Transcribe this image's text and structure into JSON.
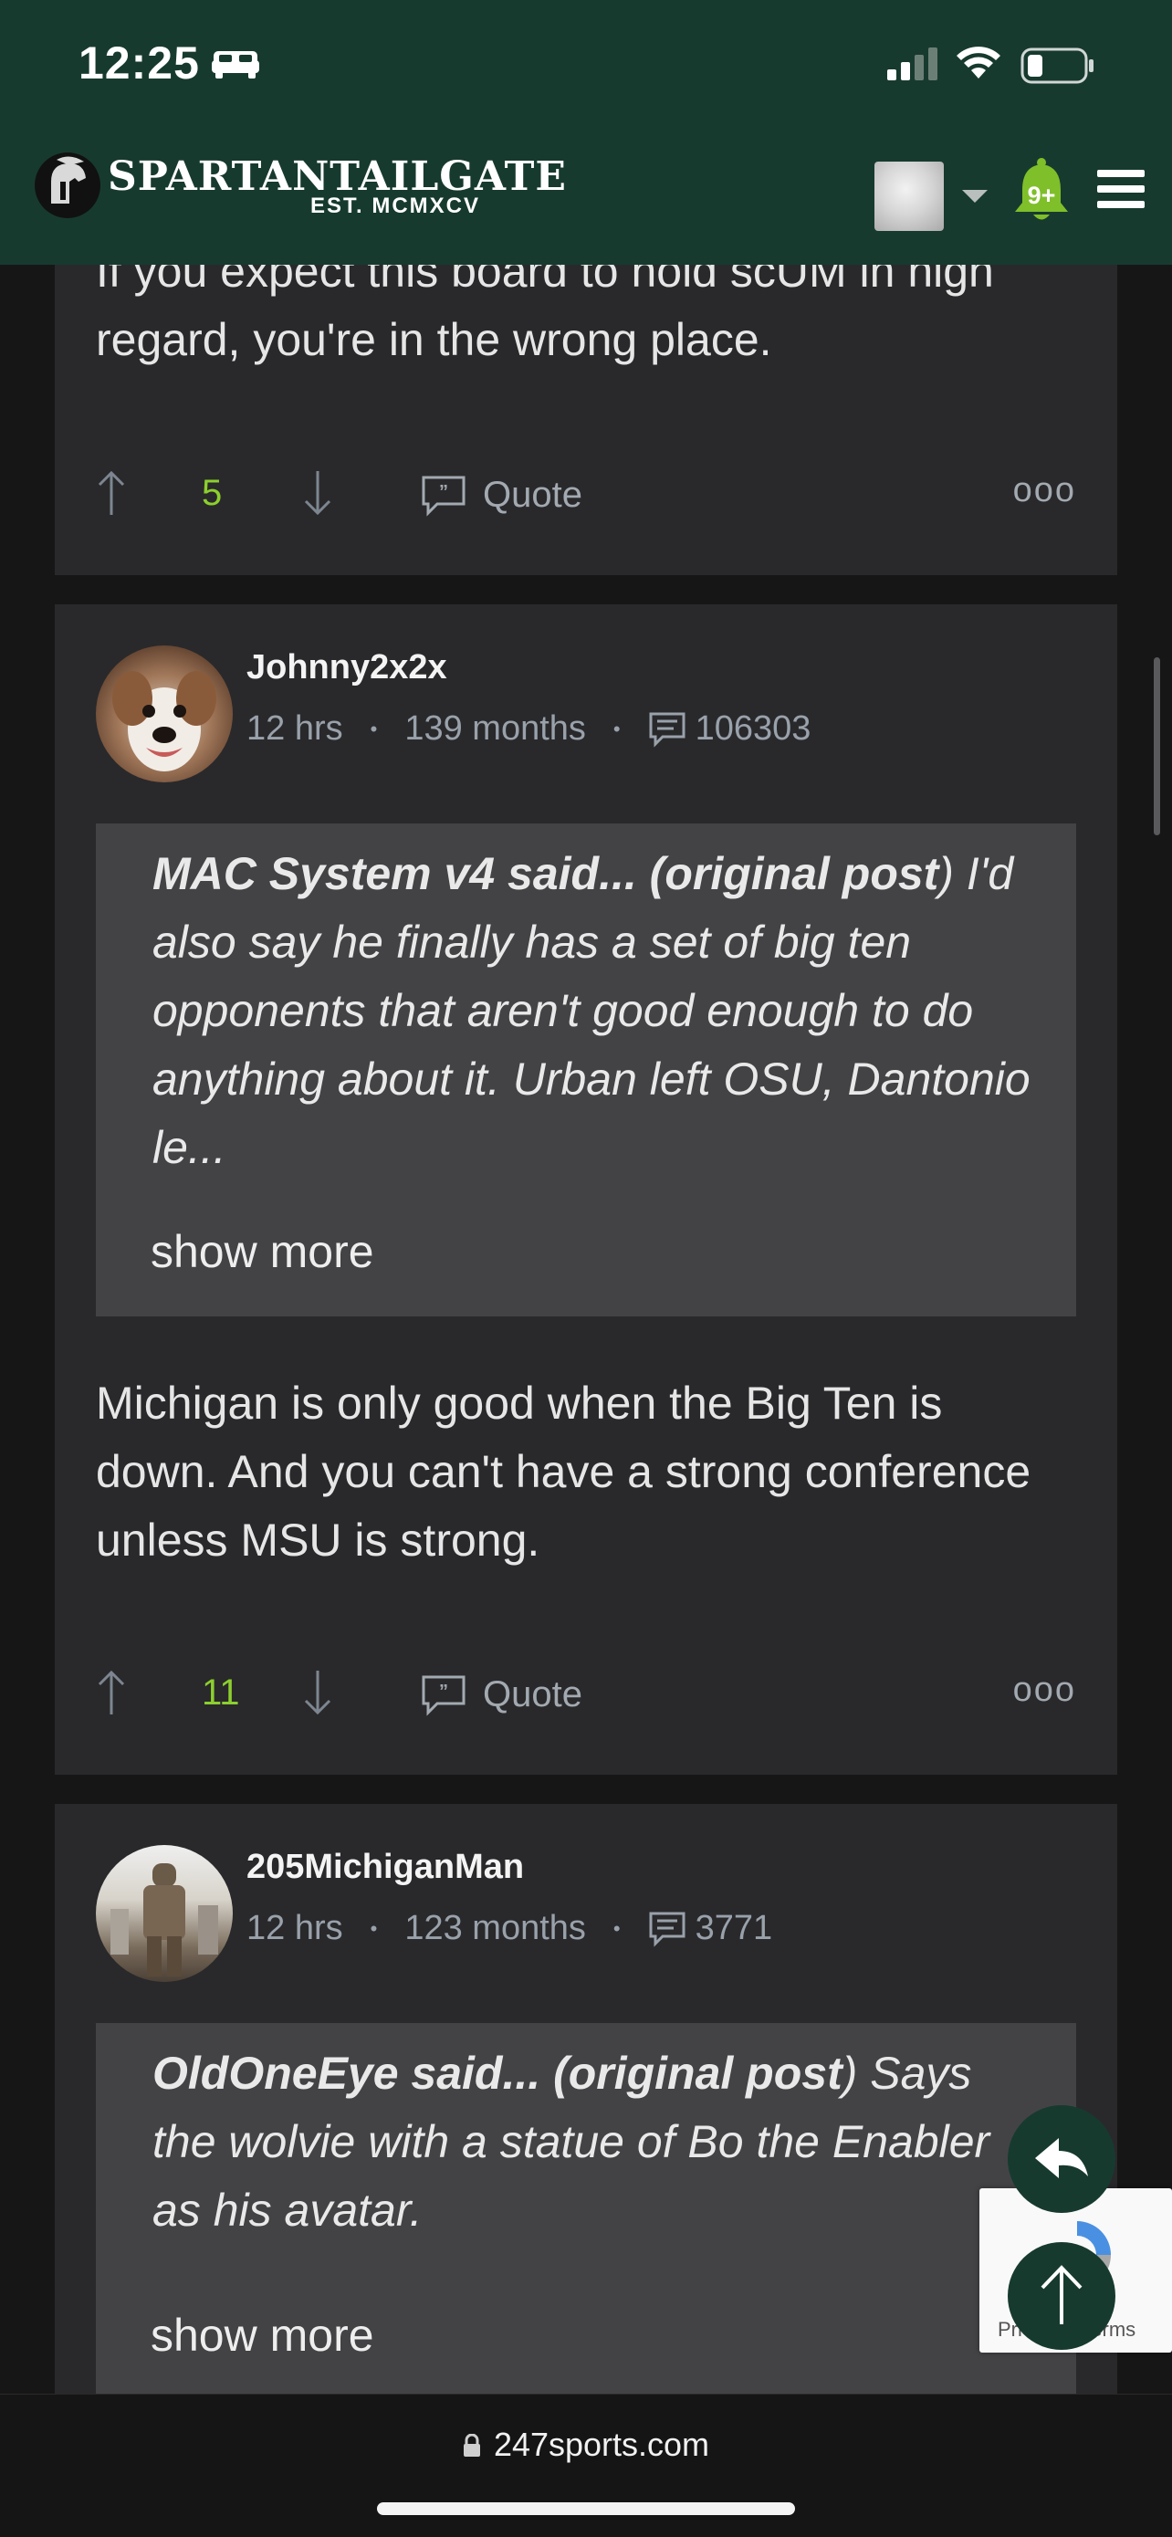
{
  "status_bar": {
    "time": "12:25"
  },
  "header": {
    "logo_text": "SPARTANTAILGATE",
    "logo_sub": "EST. MCMXCV",
    "notifications": "9+"
  },
  "posts": [
    {
      "body": "If you expect this board to hold scUM in high regard, you're in the wrong place.",
      "upvotes": "5",
      "quote_label": "Quote",
      "more_label": "ooo"
    },
    {
      "username": "Johnny2x2x",
      "time": "12 hrs",
      "membership": "139 months",
      "post_count": "106303",
      "quote_author": "MAC System v4 said...",
      "quote_ref_prefix": "(",
      "quote_ref": "original post",
      "quote_ref_suffix": ")",
      "quote_body": " I'd also say he finally has a set of big ten opponents that aren't good enough to do anything about it. Urban left OSU, Dantonio le...",
      "show_more": "show more",
      "body": "Michigan is only good when the Big Ten is down. And you can't have a strong conference unless MSU is strong.",
      "upvotes": "11",
      "quote_label": "Quote",
      "more_label": "ooo"
    },
    {
      "username": "205MichiganMan",
      "time": "12 hrs",
      "membership": "123 months",
      "post_count": "3771",
      "quote_author": "OldOneEye said...",
      "quote_ref_prefix": "(",
      "quote_ref": "original post",
      "quote_ref_suffix": ")",
      "quote_body": " Says the wolvie with a statue of Bo the Enabler as his avatar.",
      "show_more": "show more"
    }
  ],
  "recaptcha": {
    "text": "Privacy - Terms"
  },
  "browser": {
    "url": "247sports.com"
  },
  "colors": {
    "header_bg": "#173a2f",
    "card_bg": "#29292b",
    "quote_bg": "#434345",
    "upvote_green": "#8ccf2e",
    "meta_gray": "#99a1ab"
  }
}
